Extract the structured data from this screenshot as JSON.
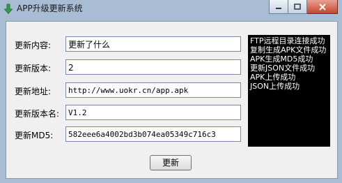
{
  "window": {
    "title": "APP升级更新系统",
    "icon": "download-arrow-icon"
  },
  "form": {
    "content_label": "更新内容:",
    "content_value": "更新了什么",
    "version_label": "更新版本:",
    "version_value": "2",
    "url_label": "更新地址:",
    "url_value": "http://www.uokr.cn/app.apk",
    "version_name_label": "更新版本名:",
    "version_name_value": "V1.2",
    "md5_label": "更新MD5:",
    "md5_value": "582eee6a4002bd3b074ea05349c716c3"
  },
  "log": {
    "lines": [
      "FTP远程目录连接成功",
      "复制生成APK文件成功",
      "APK生成MD5成功",
      "更新JSON文件成功",
      "APK上传成功",
      "JSON上传成功"
    ]
  },
  "actions": {
    "update_label": "更新"
  },
  "colors": {
    "icon_green": "#2ea043",
    "close_red": "#c6452f"
  }
}
